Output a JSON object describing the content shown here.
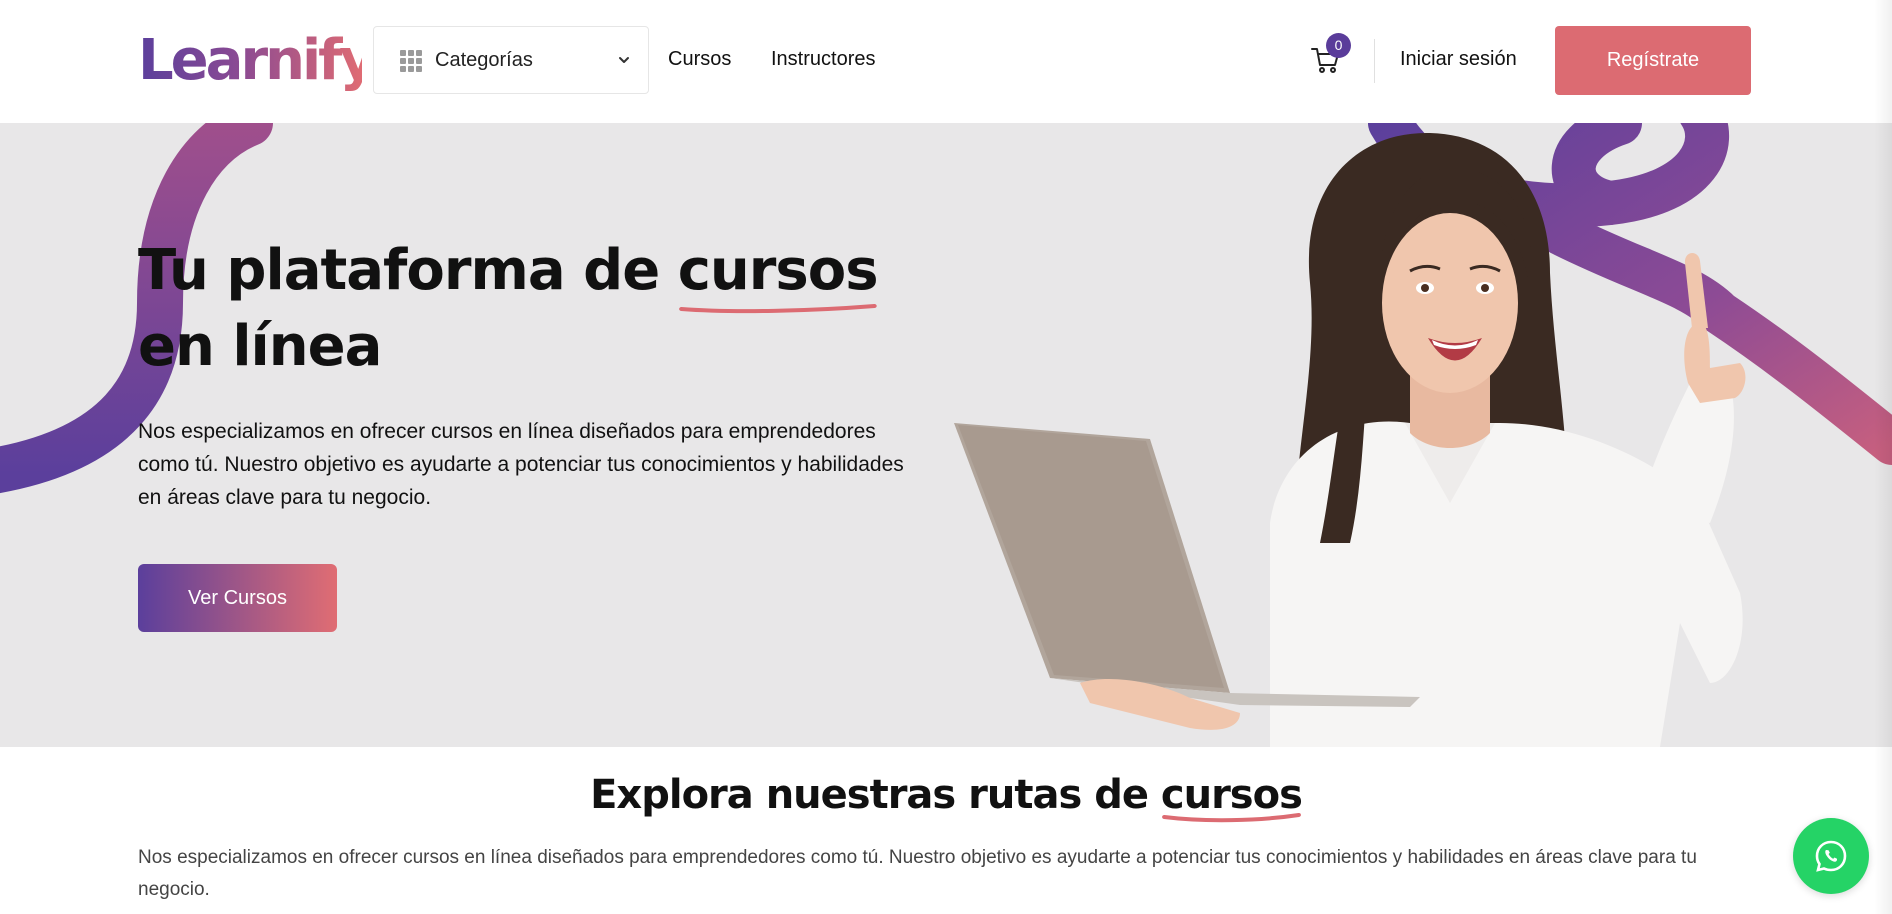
{
  "header": {
    "logo_text": "Learnify",
    "categories_label": "Categorías",
    "nav": [
      "Cursos",
      "Instructores"
    ],
    "cart_count": "0",
    "login_label": "Iniciar sesión",
    "register_label": "Regístrate"
  },
  "hero": {
    "title_part1": "Tu plataforma de ",
    "title_highlight": "cursos",
    "title_part2": " en línea",
    "description": "Nos especializamos en ofrecer cursos en línea diseñados para emprendedores como tú. Nuestro objetivo es ayudarte a potenciar tus conocimientos y habilidades en áreas clave para tu negocio.",
    "cta_label": "Ver Cursos"
  },
  "explore": {
    "title_part1": "Explora nuestras rutas de ",
    "title_highlight": "cursos",
    "description": "Nos especializamos en ofrecer cursos en línea diseñados para emprendedores como tú. Nuestro objetivo es ayudarte a potenciar tus conocimientos y habilidades en áreas clave para tu negocio."
  },
  "icons": {
    "categories": "grid-icon",
    "dropdown": "chevron-down-icon",
    "cart": "cart-icon",
    "whatsapp": "whatsapp-icon"
  },
  "colors": {
    "brand_purple": "#5a3c9a",
    "brand_coral": "#dc6b72",
    "hero_bg": "#e8e7e8",
    "whatsapp_green": "#25d366"
  }
}
